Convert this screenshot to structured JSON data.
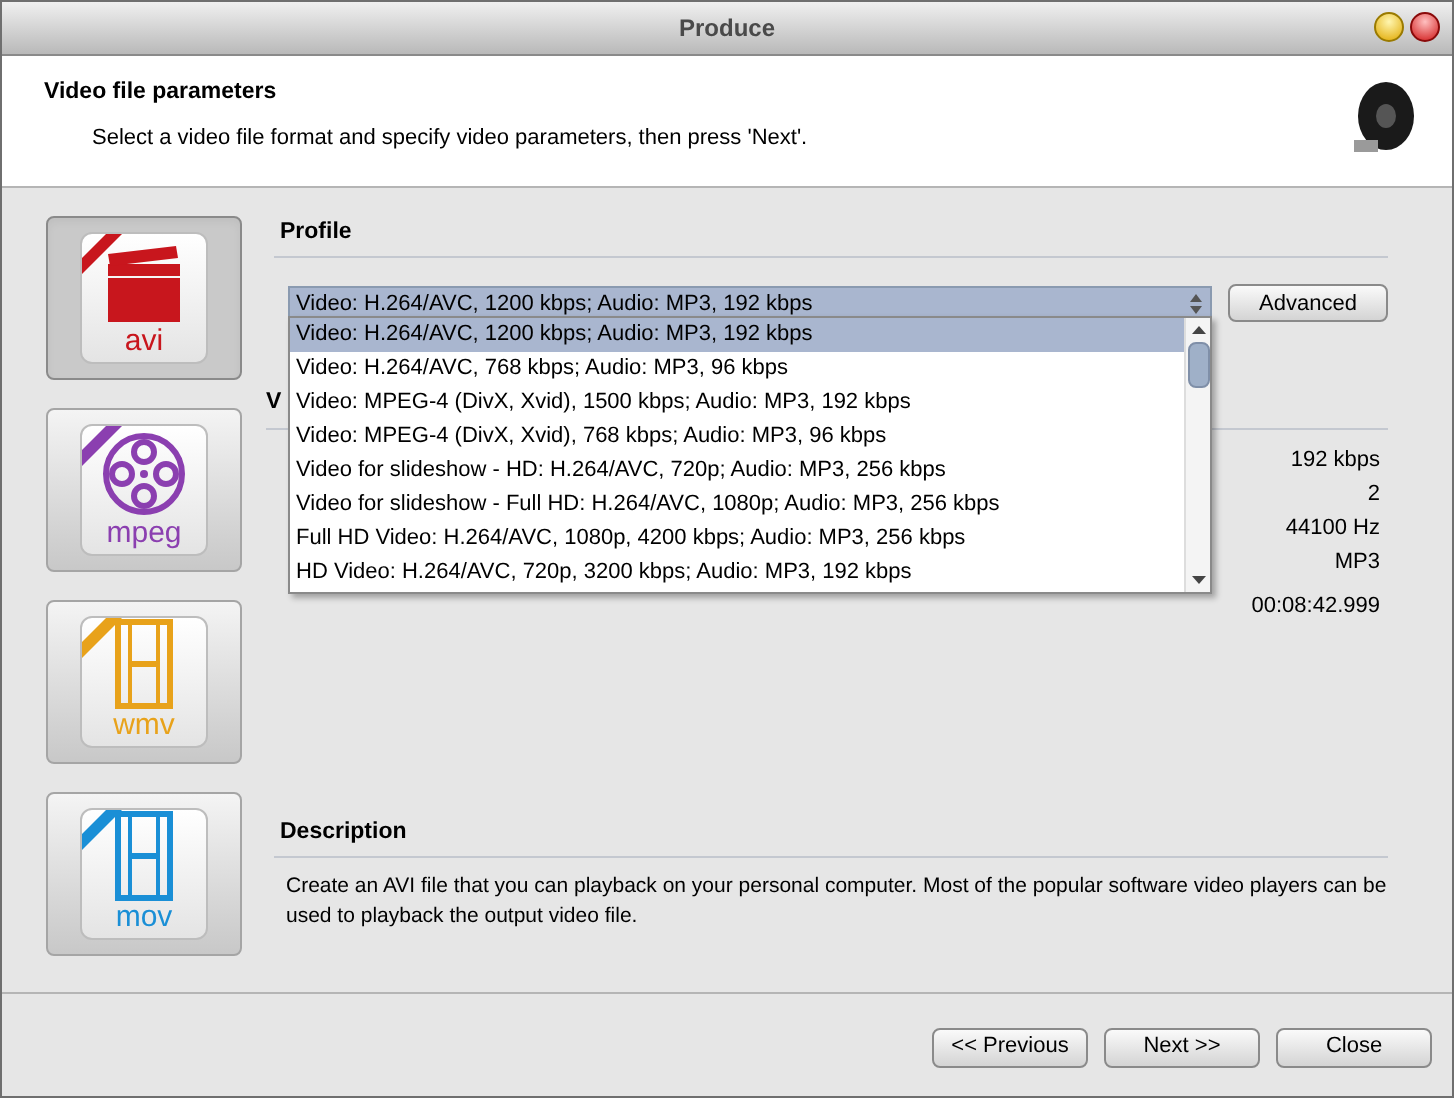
{
  "window": {
    "title": "Produce"
  },
  "header": {
    "title": "Video file parameters",
    "subtitle": "Select a video file format and specify video parameters, then press 'Next'."
  },
  "formats": [
    {
      "label": "avi",
      "color": "#c8161d",
      "selected": true
    },
    {
      "label": "mpeg",
      "color": "#8b3fb0",
      "selected": false
    },
    {
      "label": "wmv",
      "color": "#e8a21a",
      "selected": false
    },
    {
      "label": "mov",
      "color": "#1a8fd6",
      "selected": false
    }
  ],
  "profile": {
    "heading": "Profile",
    "value": "Video: H.264/AVC, 1200 kbps; Audio: MP3, 192 kbps",
    "advanced_button": "Advanced",
    "options": [
      {
        "label": "Video: H.264/AVC, 1200 kbps; Audio: MP3, 192 kbps",
        "selected": true
      },
      {
        "label": "Video: H.264/AVC, 768 kbps; Audio: MP3, 96 kbps",
        "selected": false
      },
      {
        "label": "Video: MPEG-4 (DivX, Xvid), 1500 kbps; Audio: MP3, 192 kbps",
        "selected": false
      },
      {
        "label": "Video: MPEG-4 (DivX, Xvid), 768 kbps; Audio: MP3, 96 kbps",
        "selected": false
      },
      {
        "label": "Video for slideshow - HD: H.264/AVC, 720p; Audio: MP3, 256 kbps",
        "selected": false
      },
      {
        "label": "Video for slideshow - Full HD: H.264/AVC, 1080p; Audio: MP3, 256 kbps",
        "selected": false
      },
      {
        "label": "Full HD Video: H.264/AVC, 1080p, 4200 kbps; Audio: MP3, 256 kbps",
        "selected": false
      },
      {
        "label": "HD Video: H.264/AVC, 720p, 3200 kbps; Audio: MP3, 192 kbps",
        "selected": false
      }
    ]
  },
  "parameters": {
    "heading": "V",
    "values": [
      "192 kbps",
      "2",
      "44100 Hz",
      "MP3",
      "00:08:42.999"
    ]
  },
  "description": {
    "heading": "Description",
    "text": "Create an AVI file that you can playback on your personal computer. Most of the popular software video players can be used to playback the output video file."
  },
  "buttons": [
    {
      "label": "<< Previous"
    },
    {
      "label": "Next >>"
    },
    {
      "label": "Close"
    }
  ]
}
